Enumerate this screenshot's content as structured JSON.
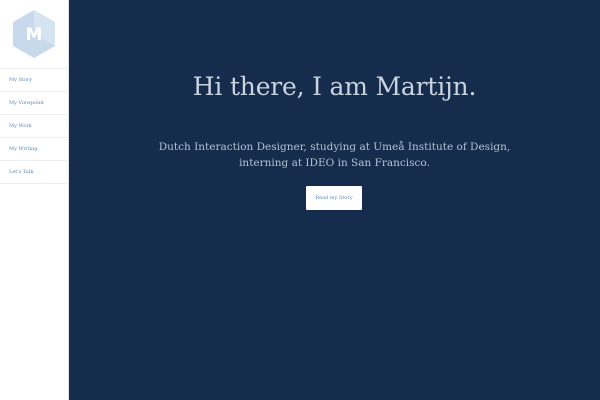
{
  "sidebar": {
    "logo_letter": "M",
    "items": [
      {
        "label": "My Story"
      },
      {
        "label": "My Viewpoint"
      },
      {
        "label": "My Work"
      },
      {
        "label": "My Writing"
      },
      {
        "label": "Let's Talk"
      }
    ]
  },
  "hero": {
    "title": "Hi there, I am Martijn.",
    "subtitle_line1": "Dutch Interaction Designer, studying at Umeå Institute of Design,",
    "subtitle_line2": "interning at IDEO in San Francisco.",
    "cta_label": "Read my Story"
  },
  "colors": {
    "main_background": "#152c4c",
    "accent": "#5a88b8",
    "logo_hexagon": "#c9d9ec",
    "title_text": "#c8d3e0"
  },
  "icons": {
    "logo": "hexagon-m-logo-icon"
  }
}
